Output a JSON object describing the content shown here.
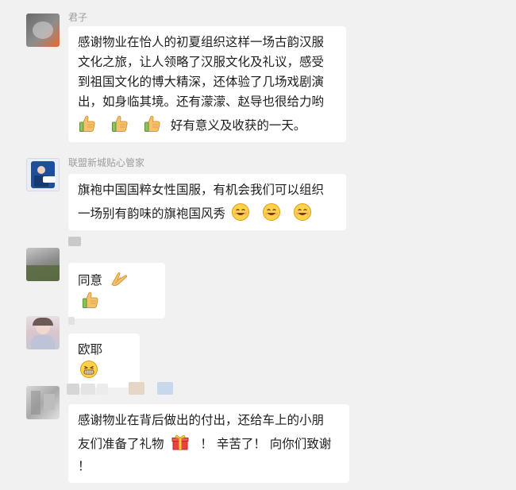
{
  "messages": [
    {
      "sender": "君子",
      "lines": [
        "感谢物业在怡人的初夏组织这样一场古韵汉服",
        "文化之旅，让人领略了汉服文化及礼议，感受",
        "到祖国文化的博大精深，还体验了几场戏剧演",
        "出，如身临其境。还有濛濛、赵导也很给力哟"
      ],
      "last_line_text": "好有意义及收获的一天。",
      "emoji_sequence": [
        "thumbs-up",
        "thumbs-up",
        "thumbs-up"
      ]
    },
    {
      "sender": "联盟新城贴心管家",
      "lines": [
        "旗袍中国国粹女性国服，有机会我们可以组织"
      ],
      "last_line_text": "一场别有韵味的旗袍国风秀",
      "emoji_sequence": [
        "grin-smile",
        "grin-smile",
        "grin-smile"
      ]
    },
    {
      "sender": "",
      "text": "同意",
      "emoji_sequence": [
        "clap",
        "thumbs-up"
      ]
    },
    {
      "sender": "",
      "text": "欧耶",
      "emoji_sequence": [
        "grin"
      ]
    },
    {
      "sender": "",
      "line1": "感谢物业在背后做出的付出，还给车上的小朋",
      "line2_before": "友们准备了礼物",
      "line2_after": "！ 辛苦了！ 向你们致谢",
      "line3": "！",
      "emoji_sequence": [
        "gift"
      ]
    }
  ],
  "colors": {
    "background": "#f1f1f1",
    "bubble": "#ffffff",
    "sender_text": "#9c9c9c",
    "avatar_teal": "#1e4f9a"
  },
  "icon_names": [
    "thumbs-up-icon",
    "grin-smile-icon",
    "clap-icon",
    "grin-icon",
    "gift-icon"
  ]
}
